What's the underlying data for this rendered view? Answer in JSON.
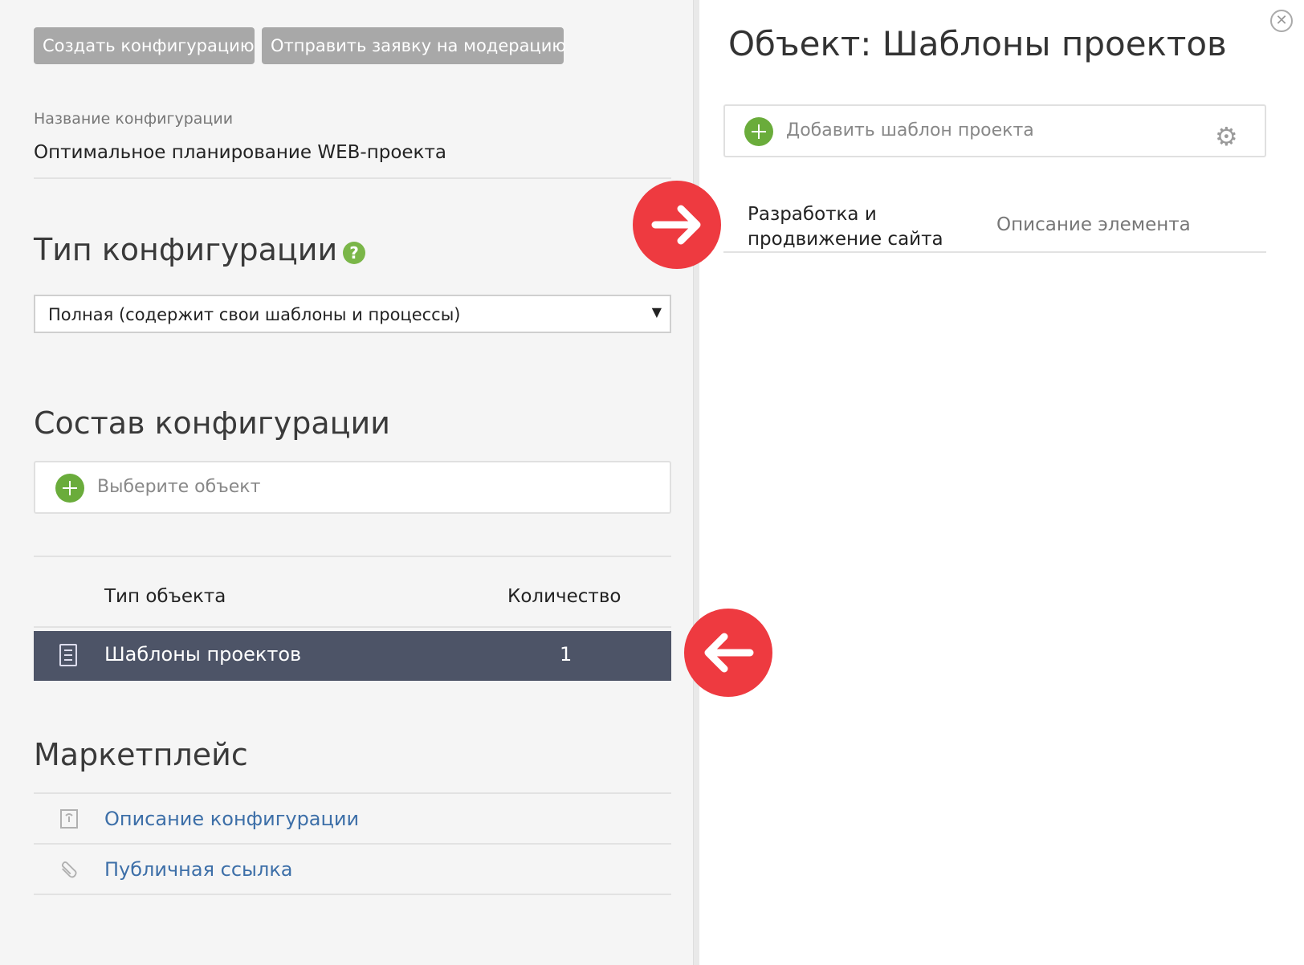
{
  "toolbar": {
    "create_label": "Создать конфигурацию",
    "moderate_label": "Отправить заявку на модерацию"
  },
  "config": {
    "name_label": "Название конфигурации",
    "name_value": "Оптимальное планирование WEB-проекта"
  },
  "type_section": {
    "title": "Тип конфигурации",
    "help_glyph": "?",
    "selected": "Полная (содержит свои шаблоны и процессы)",
    "arrow_glyph": "▼"
  },
  "composition": {
    "title": "Состав конфигурации",
    "add_placeholder": "Выберите объект",
    "headers": {
      "type": "Тип объекта",
      "count": "Количество"
    },
    "rows": [
      {
        "label": "Шаблоны проектов",
        "count": "1",
        "selected": true,
        "icon": "document-list-icon"
      }
    ]
  },
  "marketplace": {
    "title": "Маркетплейс",
    "links": [
      {
        "label": "Описание конфигурации",
        "icon": "document-info-icon"
      },
      {
        "label": "Публичная ссылка",
        "icon": "paperclip-icon"
      }
    ]
  },
  "object_panel": {
    "title": "Объект: Шаблоны проектов",
    "add_label": "Добавить шаблон проекта",
    "close_glyph": "✕",
    "gear_glyph": "⚙",
    "items": [
      {
        "name": "Разработка и продвижение сайта",
        "description": "Описание элемента"
      }
    ]
  },
  "colors": {
    "accent_green": "#6aac3b",
    "marker_red": "#ee3a40",
    "selected_row": "#4d5467",
    "link_blue": "#3d6fa8"
  }
}
